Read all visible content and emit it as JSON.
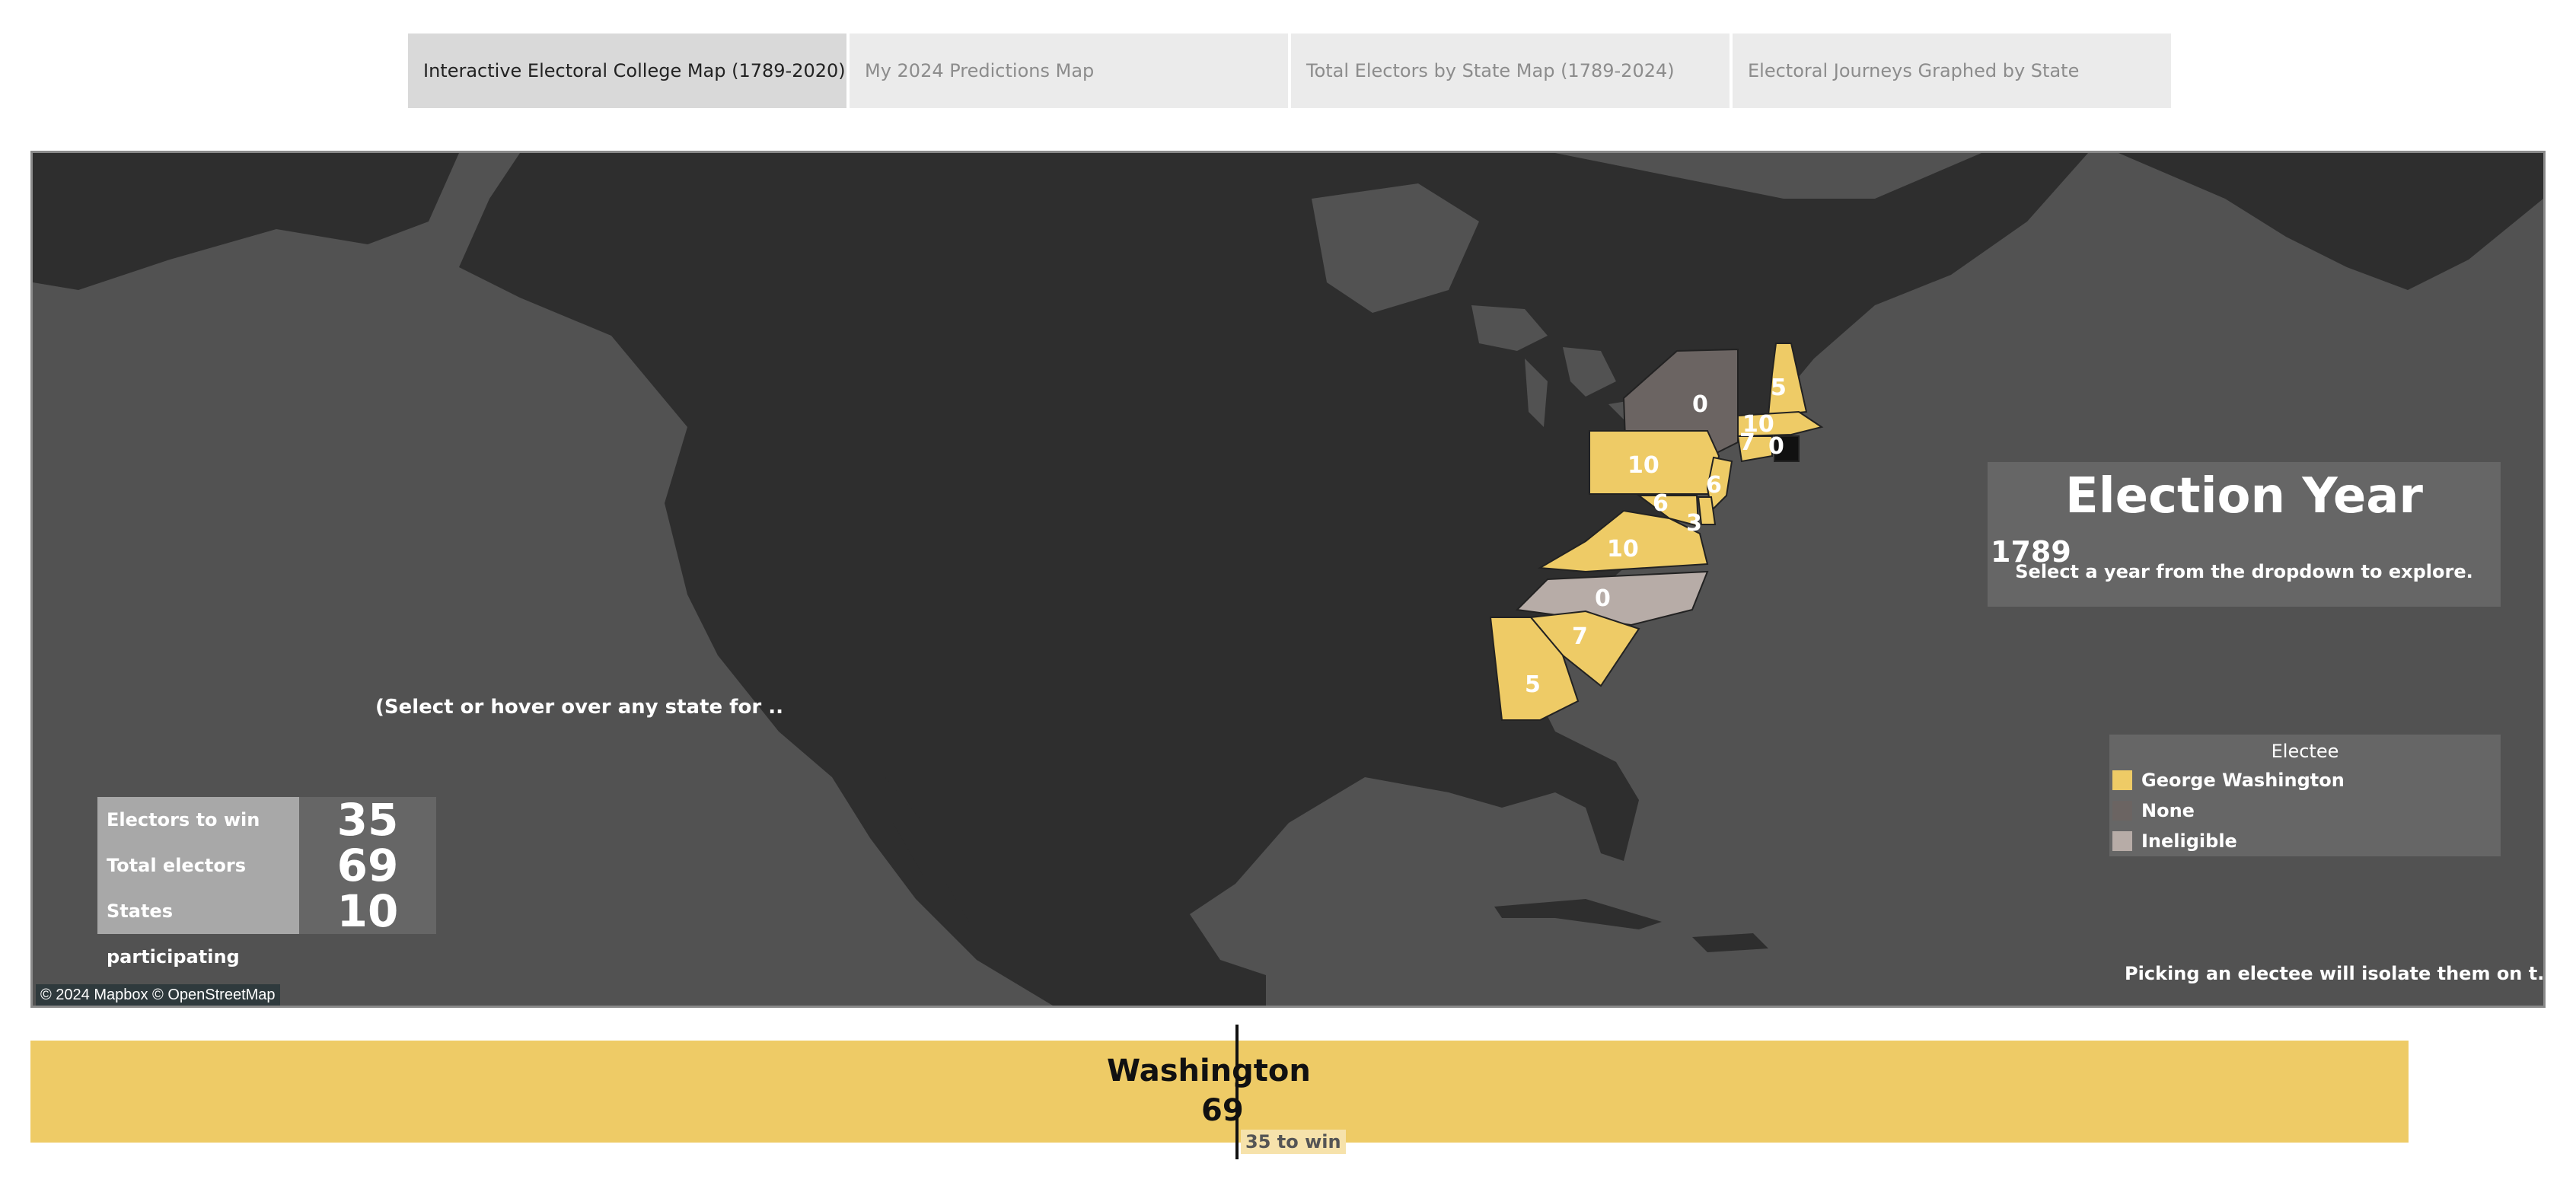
{
  "tabs": [
    {
      "label": "Interactive Electoral College Map (1789-2020)",
      "active": true
    },
    {
      "label": "My 2024 Predictions Map",
      "active": false
    },
    {
      "label": "Total Electors by State Map (1789-2024)",
      "active": false
    },
    {
      "label": "Electoral Journeys Graphed by State",
      "active": false
    }
  ],
  "map": {
    "hint_left": "(Select or hover over any state for ..",
    "hint_right": "Picking an electee will isolate them on t..",
    "attribution": "© 2024 Mapbox © OpenStreetMap",
    "state_values": {
      "ny": "0",
      "nh": "5",
      "ma": "10",
      "ct": "7",
      "ri": "0",
      "pa": "10",
      "nj": "6",
      "de": "3",
      "md": "6",
      "va": "10",
      "nc": "0",
      "sc": "7",
      "ga": "5"
    }
  },
  "stats": [
    {
      "label": "Electors to win",
      "value": "35"
    },
    {
      "label": "Total electors",
      "value": "69"
    },
    {
      "label": "States participating",
      "value": "10"
    }
  ],
  "election_year": {
    "title": "Election Year",
    "value": "1789",
    "subtitle": "Select a year from the dropdown to explore."
  },
  "legend": {
    "title": "Electee",
    "items": [
      {
        "label": "George Washington",
        "color": "#eecb66"
      },
      {
        "label": "None",
        "color": "#6b6462"
      },
      {
        "label": "Ineligible",
        "color": "#b7aca7"
      }
    ]
  },
  "bottom_bar": {
    "name": "Washington",
    "value": "69",
    "win_label": "35 to win",
    "color": "#eecb66"
  },
  "colors": {
    "map_background": "#525252",
    "land": "#2e2e2e",
    "washington": "#eecb66",
    "none": "#6b6462",
    "ineligible": "#b7aca7"
  }
}
